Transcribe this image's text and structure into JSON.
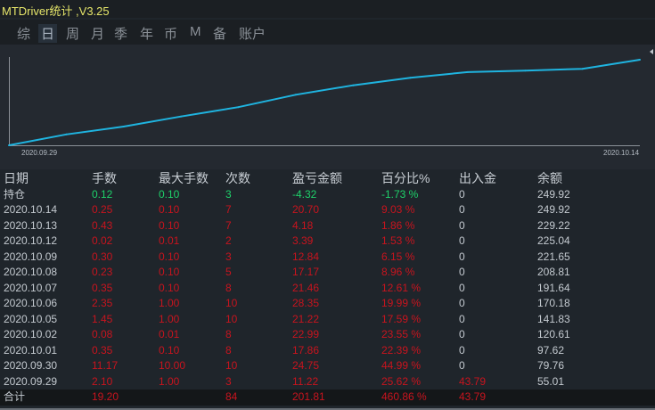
{
  "app": {
    "title": "MTDriver统计 ,V3.25"
  },
  "tabs": [
    {
      "label": "综",
      "active": false
    },
    {
      "label": "日",
      "active": true
    },
    {
      "label": "周",
      "active": false
    },
    {
      "label": "月",
      "active": false
    },
    {
      "label": "季",
      "active": false
    },
    {
      "label": "年",
      "active": false
    },
    {
      "label": "币",
      "active": false
    },
    {
      "label": "M",
      "active": false
    },
    {
      "label": "备",
      "active": false
    },
    {
      "label": "账户",
      "active": false
    }
  ],
  "chart_data": {
    "type": "line",
    "x_start_label": "2020.09.29",
    "x_end_label": "2020.10.14",
    "x": [
      "2020.09.29",
      "2020.09.30",
      "2020.10.01",
      "2020.10.02",
      "2020.10.05",
      "2020.10.06",
      "2020.10.07",
      "2020.10.08",
      "2020.10.09",
      "2020.10.12",
      "2020.10.13",
      "2020.10.14"
    ],
    "y": [
      55.01,
      79.76,
      97.62,
      120.61,
      141.83,
      170.18,
      191.64,
      208.81,
      221.65,
      225.04,
      229.22,
      249.92
    ],
    "line_color": "#1fb4e0",
    "grid": false
  },
  "table": {
    "headers": [
      "日期",
      "手数",
      "最大手数",
      "次数",
      "盈亏金额",
      "百分比%",
      "出入金",
      "余额"
    ],
    "position_row": {
      "label": "持仓",
      "lots": "0.12",
      "max_lots": "0.10",
      "count": "3",
      "pnl": "-4.32",
      "pct": "-1.73 %",
      "flow": "0",
      "balance": "249.92"
    },
    "rows": [
      {
        "date": "2020.10.14",
        "lots": "0.25",
        "max_lots": "0.10",
        "count": "7",
        "pnl": "20.70",
        "pct": "9.03 %",
        "flow": "0",
        "balance": "249.92"
      },
      {
        "date": "2020.10.13",
        "lots": "0.43",
        "max_lots": "0.10",
        "count": "7",
        "pnl": "4.18",
        "pct": "1.86 %",
        "flow": "0",
        "balance": "229.22"
      },
      {
        "date": "2020.10.12",
        "lots": "0.02",
        "max_lots": "0.01",
        "count": "2",
        "pnl": "3.39",
        "pct": "1.53 %",
        "flow": "0",
        "balance": "225.04"
      },
      {
        "date": "2020.10.09",
        "lots": "0.30",
        "max_lots": "0.10",
        "count": "3",
        "pnl": "12.84",
        "pct": "6.15 %",
        "flow": "0",
        "balance": "221.65"
      },
      {
        "date": "2020.10.08",
        "lots": "0.23",
        "max_lots": "0.10",
        "count": "5",
        "pnl": "17.17",
        "pct": "8.96 %",
        "flow": "0",
        "balance": "208.81"
      },
      {
        "date": "2020.10.07",
        "lots": "0.35",
        "max_lots": "0.10",
        "count": "8",
        "pnl": "21.46",
        "pct": "12.61 %",
        "flow": "0",
        "balance": "191.64"
      },
      {
        "date": "2020.10.06",
        "lots": "2.35",
        "max_lots": "1.00",
        "count": "10",
        "pnl": "28.35",
        "pct": "19.99 %",
        "flow": "0",
        "balance": "170.18"
      },
      {
        "date": "2020.10.05",
        "lots": "1.45",
        "max_lots": "1.00",
        "count": "10",
        "pnl": "21.22",
        "pct": "17.59 %",
        "flow": "0",
        "balance": "141.83"
      },
      {
        "date": "2020.10.02",
        "lots": "0.08",
        "max_lots": "0.01",
        "count": "8",
        "pnl": "22.99",
        "pct": "23.55 %",
        "flow": "0",
        "balance": "120.61"
      },
      {
        "date": "2020.10.01",
        "lots": "0.35",
        "max_lots": "0.10",
        "count": "8",
        "pnl": "17.86",
        "pct": "22.39 %",
        "flow": "0",
        "balance": "97.62"
      },
      {
        "date": "2020.09.30",
        "lots": "11.17",
        "max_lots": "10.00",
        "count": "10",
        "pnl": "24.75",
        "pct": "44.99 %",
        "flow": "0",
        "balance": "79.76"
      },
      {
        "date": "2020.09.29",
        "lots": "2.10",
        "max_lots": "1.00",
        "count": "3",
        "pnl": "11.22",
        "pct": "25.62 %",
        "flow": "43.79",
        "balance": "55.01"
      }
    ],
    "total_row": {
      "label": "合计",
      "lots": "19.20",
      "count": "84",
      "pnl": "201.81",
      "pct": "460.86 %",
      "flow": "43.79"
    }
  },
  "colors": {
    "profit": "#c8141e",
    "loss": "#1fd16a",
    "title": "#e6e66a"
  }
}
